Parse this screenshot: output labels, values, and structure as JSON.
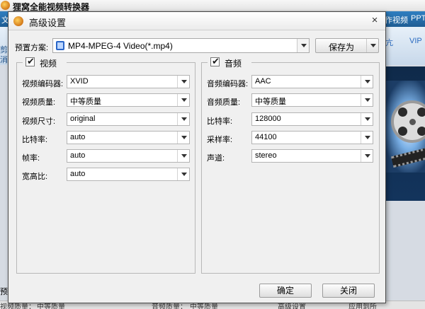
{
  "app": {
    "title": "狸窝全能视频转换器",
    "menu": [
      "文",
      "作视频",
      "PPT"
    ],
    "sidebar_glyphs": [
      "剪",
      "消"
    ],
    "toolbar_links": [
      "亢",
      "VIP"
    ],
    "left_preview_label": "预",
    "bottom_bar": [
      "视频质量：",
      "中等质量",
      "音频质量：",
      "中等质量",
      "高级设置",
      "应用到所"
    ]
  },
  "dialog": {
    "title": "高级设置",
    "close_glyph": "×",
    "preset": {
      "label": "预置方案:",
      "value": "MP4-MPEG-4 Video(*.mp4)",
      "save_as": "保存为"
    },
    "video": {
      "title": "视频",
      "checked": true,
      "check_glyph": "✔",
      "rows": [
        {
          "label": "视频编码器:",
          "value": "XVID"
        },
        {
          "label": "视频质量:",
          "value": "中等质量"
        },
        {
          "label": "视频尺寸:",
          "value": "original"
        },
        {
          "label": "比特率:",
          "value": "auto"
        },
        {
          "label": "帧率:",
          "value": "auto"
        },
        {
          "label": "宽高比:",
          "value": "auto"
        }
      ]
    },
    "audio": {
      "title": "音频",
      "checked": true,
      "check_glyph": "✔",
      "rows": [
        {
          "label": "音频编码器:",
          "value": "AAC"
        },
        {
          "label": "音频质量:",
          "value": "中等质量"
        },
        {
          "label": "比特率:",
          "value": "128000"
        },
        {
          "label": "采样率:",
          "value": "44100"
        },
        {
          "label": "声道:",
          "value": "stereo"
        }
      ]
    },
    "ok_label": "确定",
    "cancel_label": "关闭"
  }
}
